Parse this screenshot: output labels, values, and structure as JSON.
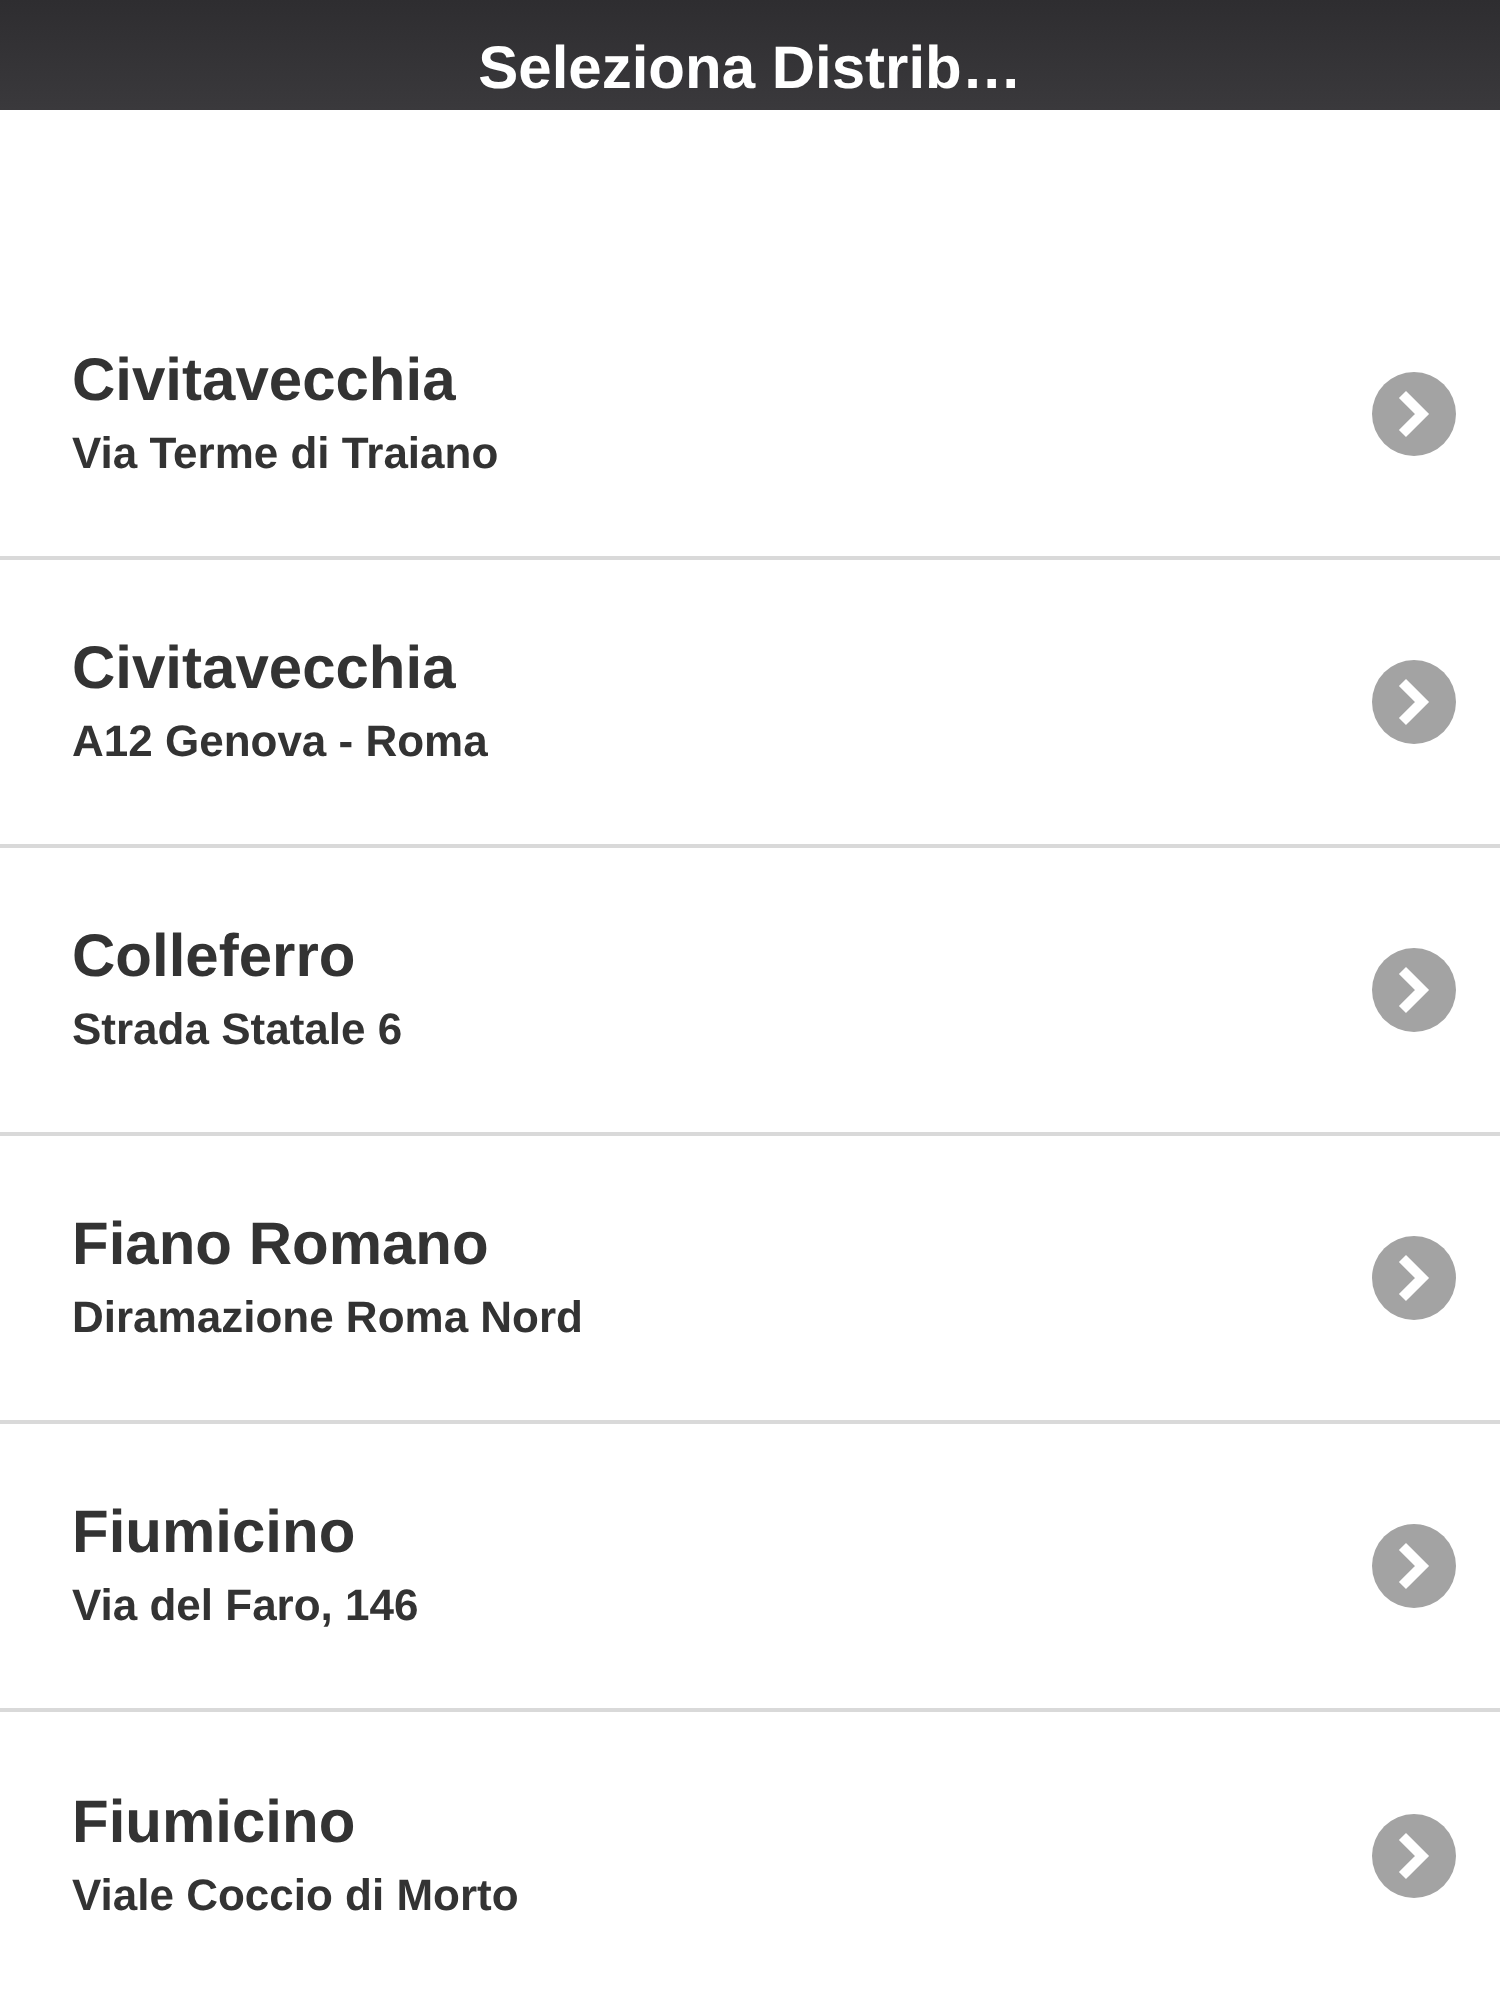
{
  "header": {
    "title": "Seleziona Distrib…"
  },
  "items": [
    {
      "title": "Civitavecchia",
      "subtitle": "Via Terme di Traiano"
    },
    {
      "title": "Civitavecchia",
      "subtitle": "A12 Genova - Roma"
    },
    {
      "title": "Colleferro",
      "subtitle": "Strada Statale 6"
    },
    {
      "title": "Fiano Romano",
      "subtitle": "Diramazione Roma Nord"
    },
    {
      "title": "Fiumicino",
      "subtitle": "Via del Faro, 146"
    },
    {
      "title": "Fiumicino",
      "subtitle": "Viale Coccio di Morto"
    }
  ]
}
